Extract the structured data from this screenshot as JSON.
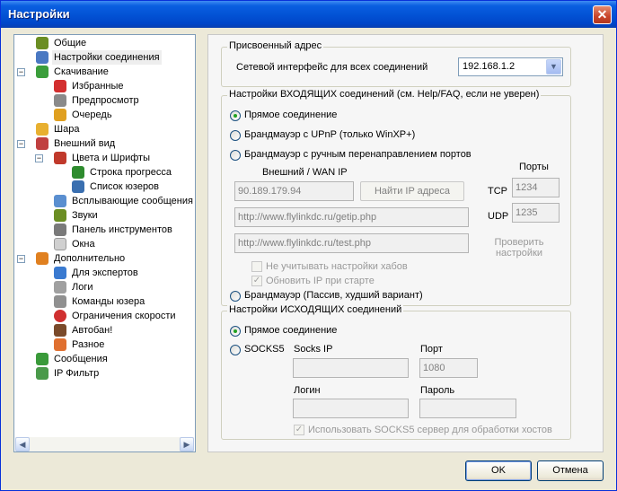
{
  "window": {
    "title": "Настройки",
    "close_symbol": "✕"
  },
  "tree": {
    "items": [
      {
        "label": "Общие",
        "icon": "tools-icon",
        "color": "#6b8e23"
      },
      {
        "label": "Настройки соединения",
        "icon": "network-icon",
        "color": "#4a78c2"
      },
      {
        "label": "Скачивание",
        "icon": "download-icon",
        "color": "#3b9e3b"
      },
      {
        "label": "Избранные",
        "icon": "heart-icon",
        "color": "#d32f2f"
      },
      {
        "label": "Предпросмотр",
        "icon": "preview-icon",
        "color": "#8a8a8a"
      },
      {
        "label": "Очередь",
        "icon": "queue-icon",
        "color": "#e0a020"
      },
      {
        "label": "Шара",
        "icon": "share-icon",
        "color": "#e8b030"
      },
      {
        "label": "Внешний вид",
        "icon": "appearance-icon",
        "color": "#c04040"
      },
      {
        "label": "Цвета и Шрифты",
        "icon": "palette-icon",
        "color": "#c0392b"
      },
      {
        "label": "Строка прогресса",
        "icon": "progressbar-icon",
        "color": "#2e8b2e"
      },
      {
        "label": "Список юзеров",
        "icon": "userlist-icon",
        "color": "#3a6fb0"
      },
      {
        "label": "Всплывающие сообщения",
        "icon": "popup-icon",
        "color": "#5a8fd0"
      },
      {
        "label": "Звуки",
        "icon": "sound-icon",
        "color": "#6b8e23"
      },
      {
        "label": "Панель инструментов",
        "icon": "toolbar-icon",
        "color": "#7a7a7a"
      },
      {
        "label": "Окна",
        "icon": "windows-icon",
        "color": "#d0d0d0"
      },
      {
        "label": "Дополнительно",
        "icon": "advanced-icon",
        "color": "#e08020"
      },
      {
        "label": "Для экспертов",
        "icon": "expert-icon",
        "color": "#3a7ad0"
      },
      {
        "label": "Логи",
        "icon": "log-icon",
        "color": "#a0a0a0"
      },
      {
        "label": "Команды юзера",
        "icon": "commands-icon",
        "color": "#909090"
      },
      {
        "label": "Ограничения скорости",
        "icon": "speed-limit-icon",
        "color": "#d03030"
      },
      {
        "label": "Автобан!",
        "icon": "autoban-icon",
        "color": "#7a4a2a"
      },
      {
        "label": "Разное",
        "icon": "misc-icon",
        "color": "#e07030"
      },
      {
        "label": "Сообщения",
        "icon": "messages-icon",
        "color": "#3a9a3a"
      },
      {
        "label": "IP Фильтр",
        "icon": "ipfilter-icon",
        "color": "#4a9a4a"
      }
    ],
    "expander_minus": "−"
  },
  "assigned": {
    "title": "Присвоенный адрес",
    "iface_label": "Сетевой интерфейс для всех соединений",
    "iface_value": "192.168.1.2"
  },
  "incoming": {
    "title": "Настройки ВХОДЯЩИХ соединений (см. Help/FAQ, если не уверен)",
    "direct": "Прямое соединение",
    "upnp": "Брандмауэр с UPnP (только WinXP+)",
    "manual": "Брандмауэр с ручным перенаправлением портов",
    "wan_label": "Внешний / WAN IP",
    "wan_value": "90.189.179.94",
    "find_ip": "Найти IP адреса",
    "ports_label": "Порты",
    "tcp_label": "TCP",
    "tcp_value": "1234",
    "udp_label": "UDP",
    "udp_value": "1235",
    "getip_url": "http://www.flylinkdc.ru/getip.php",
    "test_url": "http://www.flylinkdc.ru/test.php",
    "check_settings_line1": "Проверить",
    "check_settings_line2": "настройки",
    "ignore_hubs": "Не учитывать настройки хабов",
    "update_ip": "Обновить IP при старте",
    "passive": "Брандмауэр (Пассив, худший вариант)"
  },
  "outgoing": {
    "title": "Настройки ИСХОДЯЩИХ соединений",
    "direct": "Прямое соединение",
    "socks5": "SOCKS5",
    "socks_ip_label": "Socks IP",
    "port_label": "Порт",
    "port_value": "1080",
    "login_label": "Логин",
    "password_label": "Пароль",
    "use_socks_hosts": "Использовать SOCKS5 сервер для обработки хостов"
  },
  "buttons": {
    "ok": "OK",
    "cancel": "Отмена"
  },
  "icons": {
    "combo_arrow": "▼",
    "scroll_left": "◀",
    "scroll_right": "▶",
    "check": "✓"
  }
}
